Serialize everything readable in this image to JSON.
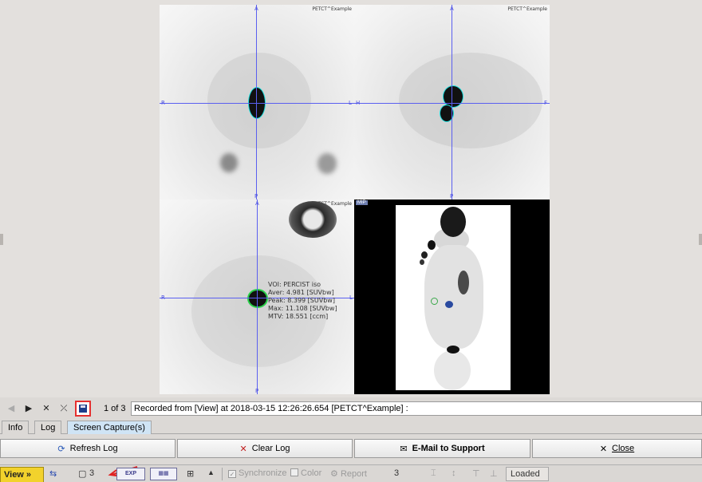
{
  "panes": {
    "caption": "PETCT^Example",
    "orient": {
      "top": "A",
      "bottom": "P",
      "left": "R",
      "right": "L",
      "right_sag": "F",
      "left_sag": "H"
    },
    "mip_tag": "MIP",
    "voi": {
      "name": "VOI: PERCIST iso",
      "aver": "Aver: 4.981 [SUVbw]",
      "peak": "Peak: 8.399 [SUVbw]",
      "max": "Max: 11.108 [SUVbw]",
      "mtv": "MTV: 18.551 [ccm]"
    }
  },
  "capture_bar": {
    "page_count": "1 of 3",
    "record_text": "Recorded from [View] at 2018-03-15 12:26:26.654 [PETCT^Example] :"
  },
  "tabs": [
    "Info",
    "Log",
    "Screen Capture(s)"
  ],
  "actions": {
    "refresh": "Refresh Log",
    "clear": "Clear Log",
    "email": "E-Mail to Support",
    "close": "Close"
  },
  "status_bar": {
    "view_label": "View »",
    "count_a": "3",
    "exp_label": "EXP",
    "synchronize": "Synchronize",
    "color": "Color",
    "report": "Report",
    "count_b": "3",
    "loaded": "Loaded"
  },
  "colors": {
    "crosshair": "#5a5ff0",
    "highlight": "#e53030",
    "view_button": "#f2d22c"
  }
}
